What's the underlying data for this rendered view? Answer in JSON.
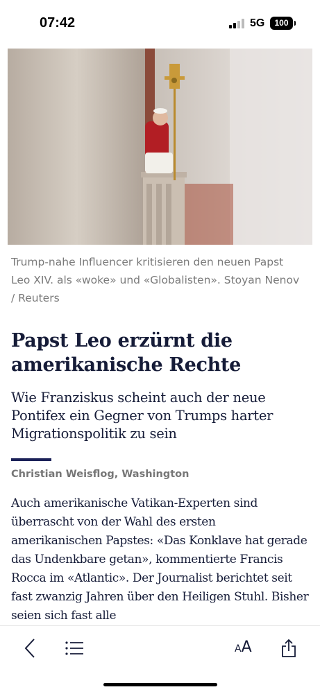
{
  "status_bar": {
    "time": "07:42",
    "network": "5G",
    "battery": "100"
  },
  "article": {
    "hero_image": "pope-on-balcony-photo",
    "caption": "Trump-nahe Influencer kritisieren den neuen Papst Leo XIV. als «woke» und «Globalisten». Stoyan Nenov / Reuters",
    "headline": "Papst Leo erzürnt die amerikanische Rechte",
    "lead": "Wie Franziskus scheint auch der neue Pontifex ein Gegner von Trumps harter Migrationspolitik zu sein",
    "byline": "Christian Weisflog, Washington",
    "body": "Auch amerikanische Vatikan-Experten sind überrascht von der Wahl des ersten amerikanischen Papstes: «Das Konklave hat gerade das Undenkbare getan», kommentierte Francis Rocca im «Atlantic». Der Journalist berichtet seit fast zwanzig Jahren über den Heiligen Stuhl. Bisher seien sich fast alle"
  },
  "toolbar": {
    "font_size_small": "A",
    "font_size_large": "A",
    "icons": [
      "back-chevron-icon",
      "list-icon",
      "font-size-icon",
      "share-icon"
    ]
  },
  "colors": {
    "headline": "#161c38",
    "accent_rule": "#1b2158",
    "caption": "#7a7a7a"
  }
}
